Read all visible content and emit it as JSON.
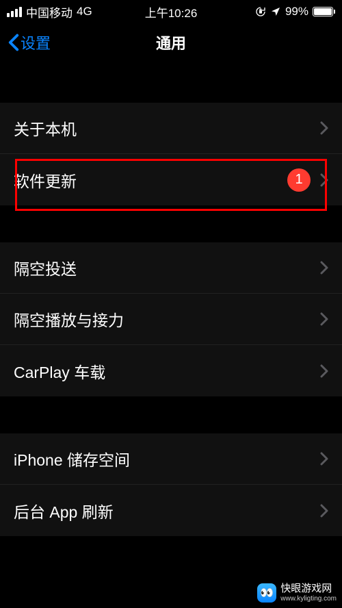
{
  "statusbar": {
    "carrier": "中国移动",
    "network": "4G",
    "time": "上午10:26",
    "battery_pct": "99%"
  },
  "nav": {
    "back_label": "设置",
    "title": "通用"
  },
  "groups": [
    {
      "items": [
        {
          "key": "about",
          "label": "关于本机",
          "badge": null
        },
        {
          "key": "software-update",
          "label": "软件更新",
          "badge": "1"
        }
      ]
    },
    {
      "items": [
        {
          "key": "airdrop",
          "label": "隔空投送",
          "badge": null
        },
        {
          "key": "airplay-handoff",
          "label": "隔空播放与接力",
          "badge": null
        },
        {
          "key": "carplay",
          "label": "CarPlay 车载",
          "badge": null
        }
      ]
    },
    {
      "items": [
        {
          "key": "iphone-storage",
          "label": "iPhone 储存空间",
          "badge": null
        },
        {
          "key": "background-app-refresh",
          "label": "后台 App 刷新",
          "badge": null
        }
      ]
    }
  ],
  "watermark": {
    "title": "快眼游戏网",
    "sub": "www.kyligting.com"
  }
}
